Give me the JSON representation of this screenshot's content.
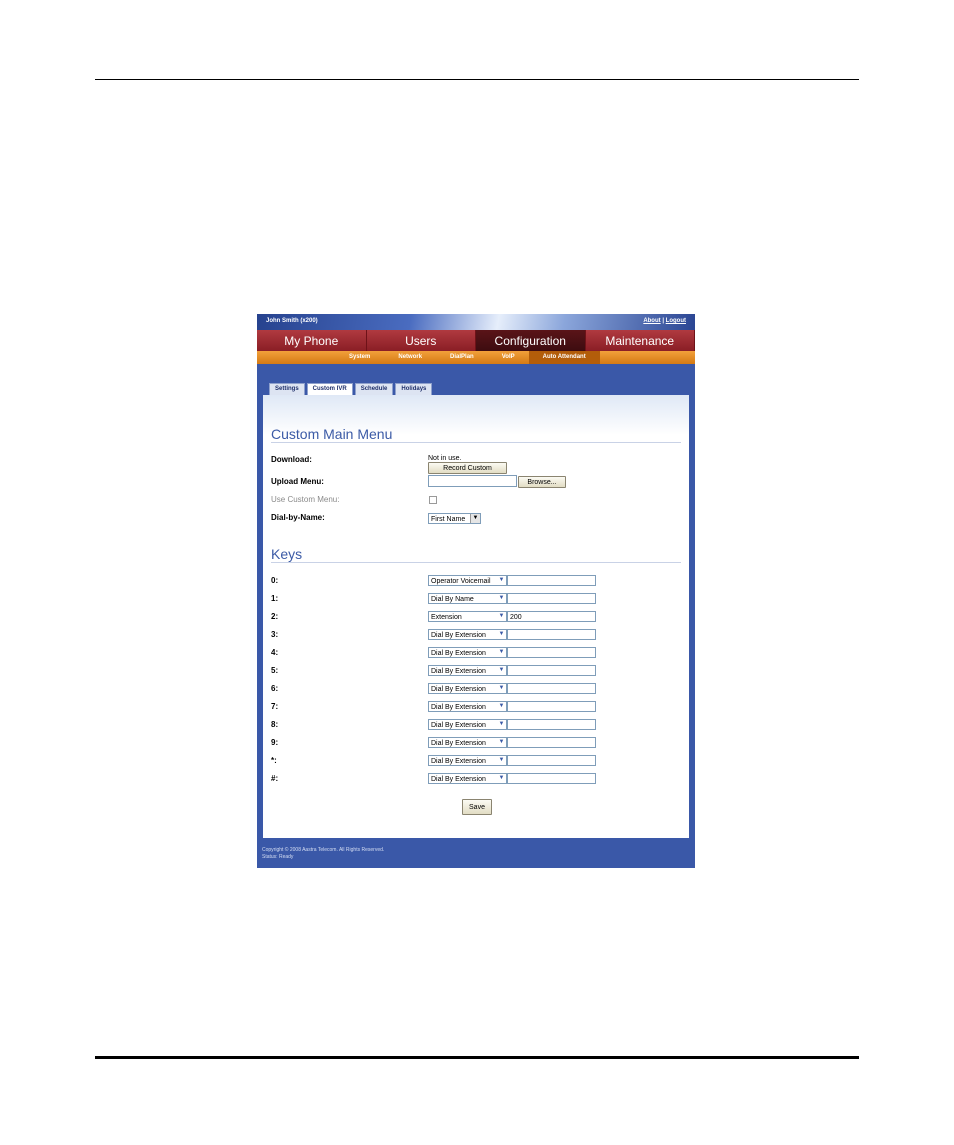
{
  "header": {
    "user": "John Smith (x200)",
    "about": "About",
    "separator": "|",
    "logout": "Logout"
  },
  "main_nav": [
    {
      "label": "My Phone"
    },
    {
      "label": "Users"
    },
    {
      "label": "Configuration"
    },
    {
      "label": "Maintenance"
    }
  ],
  "sub_nav": [
    {
      "label": "System"
    },
    {
      "label": "Network"
    },
    {
      "label": "DialPlan"
    },
    {
      "label": "VoIP"
    },
    {
      "label": "Auto Attendant"
    }
  ],
  "tabs": [
    {
      "label": "Settings"
    },
    {
      "label": "Custom IVR"
    },
    {
      "label": "Schedule"
    },
    {
      "label": "Holidays"
    }
  ],
  "custom_menu": {
    "title": "Custom Main Menu",
    "download_label": "Download:",
    "download_value": "Not in use.",
    "record_button": "Record Custom",
    "upload_label": "Upload Menu:",
    "browse_button": "Browse...",
    "use_custom_label": "Use Custom Menu:",
    "dial_by_name_label": "Dial-by-Name:",
    "dial_by_name_value": "First Name"
  },
  "keys": {
    "title": "Keys",
    "rows": [
      {
        "key": "0:",
        "action": "Operator Voicemail",
        "value": ""
      },
      {
        "key": "1:",
        "action": "Dial By Name",
        "value": ""
      },
      {
        "key": "2:",
        "action": "Extension",
        "value": "200"
      },
      {
        "key": "3:",
        "action": "Dial By Extension",
        "value": ""
      },
      {
        "key": "4:",
        "action": "Dial By Extension",
        "value": ""
      },
      {
        "key": "5:",
        "action": "Dial By Extension",
        "value": ""
      },
      {
        "key": "6:",
        "action": "Dial By Extension",
        "value": ""
      },
      {
        "key": "7:",
        "action": "Dial By Extension",
        "value": ""
      },
      {
        "key": "8:",
        "action": "Dial By Extension",
        "value": ""
      },
      {
        "key": "9:",
        "action": "Dial By Extension",
        "value": ""
      },
      {
        "key": "*:",
        "action": "Dial By Extension",
        "value": ""
      },
      {
        "key": "#:",
        "action": "Dial By Extension",
        "value": ""
      }
    ]
  },
  "save_button": "Save",
  "footer": {
    "copyright": "Copyright © 2008 Aastra Telecom. All Rights Reserved.",
    "status": "Status: Ready"
  }
}
